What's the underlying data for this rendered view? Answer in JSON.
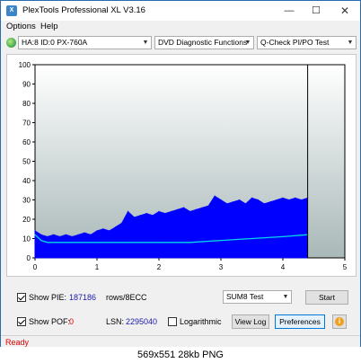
{
  "window": {
    "title": "PlexTools Professional XL V3.16",
    "min_glyph": "—",
    "max_glyph": "☐",
    "close_glyph": "✕"
  },
  "menu": {
    "options": "Options",
    "help": "Help"
  },
  "toolbar": {
    "drive": "HA:8 ID:0  PX-760A",
    "function": "DVD Diagnostic Functions",
    "test": "Q-Check PI/PO Test",
    "arrow": "▼"
  },
  "chart_data": {
    "type": "area",
    "x_ticks": [
      "0",
      "1",
      "2",
      "3",
      "4",
      "5"
    ],
    "y_ticks": [
      "0",
      "10",
      "20",
      "30",
      "40",
      "50",
      "60",
      "70",
      "80",
      "90",
      "100"
    ],
    "xlim": [
      0,
      5
    ],
    "ylim": [
      0,
      100
    ],
    "end_marker_x": 4.4,
    "colors": {
      "pie": "#0000ff",
      "average": "#00d8e8",
      "end_marker": "#000000",
      "bg_top": "#ffffff",
      "bg_bottom": "#a9b8b8"
    },
    "series": [
      {
        "x": [
          0,
          0.1,
          0.2,
          0.3,
          0.4,
          0.5,
          0.6,
          0.7,
          0.8,
          0.9,
          1.0,
          1.1,
          1.2,
          1.3,
          1.4,
          1.5,
          1.6,
          1.7,
          1.8,
          1.9,
          2.0,
          2.1,
          2.2,
          2.3,
          2.4,
          2.5,
          2.6,
          2.7,
          2.8,
          2.9,
          3.0,
          3.1,
          3.2,
          3.3,
          3.4,
          3.5,
          3.6,
          3.7,
          3.8,
          3.9,
          4.0,
          4.1,
          4.2,
          4.3,
          4.4
        ],
        "values": [
          14,
          12,
          11,
          12,
          11,
          12,
          11,
          12,
          13,
          12,
          14,
          15,
          14,
          16,
          18,
          24,
          21,
          22,
          23,
          22,
          24,
          23,
          24,
          25,
          26,
          24,
          25,
          26,
          27,
          32,
          30,
          28,
          29,
          30,
          28,
          31,
          30,
          28,
          29,
          30,
          31,
          30,
          31,
          30,
          31
        ]
      },
      {
        "x": [
          0,
          0.1,
          0.2,
          0.5,
          1.0,
          1.5,
          2.0,
          2.5,
          3.0,
          3.5,
          4.0,
          4.4
        ],
        "values": [
          12,
          9,
          8,
          8,
          8,
          8,
          8,
          8,
          9,
          10,
          11,
          12
        ]
      }
    ]
  },
  "controls": {
    "show_pie_label": "Show PIE:",
    "pie_value": "187186",
    "pie_unit": "rows/8ECC",
    "show_poe_label": "Show POF:",
    "poe_value": "0",
    "lsn_label": "LSN:",
    "lsn_value": "2295040",
    "logarithmic_label": "Logarithmic",
    "sum8_select": "SUM8 Test",
    "start_button": "Start",
    "view_log_button": "View Log",
    "preferences_button": "Preferences",
    "info_glyph": "i"
  },
  "status": {
    "text": "Ready"
  },
  "caption": {
    "text": "569x551  28kb  PNG"
  }
}
